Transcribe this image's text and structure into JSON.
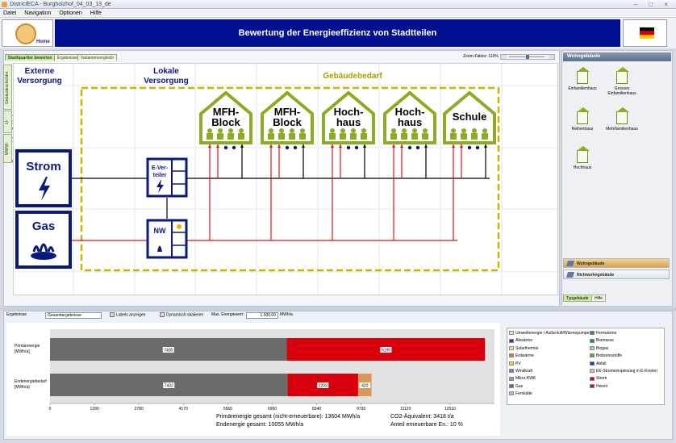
{
  "window": {
    "title": "DistrictECA - Burgholzhof_04_03_13_de",
    "controls": [
      "–",
      "□",
      "×"
    ]
  },
  "menu": [
    "Datei",
    "Navigation",
    "Optionen",
    "Hilfe"
  ],
  "header": {
    "home_label": "Home",
    "banner_title": "Bewertung der Energieeffizienz von Stadtteilen"
  },
  "tabs": [
    "Stadtquartier bewerten",
    "Ergebnisse",
    "Variantenvergleich"
  ],
  "zoom": {
    "label": "Zoom-Faktor: 110%",
    "value": 110
  },
  "side_tabs": [
    "Gebäudeschichtnr.",
    "IJ-Gebäude",
    "WWW-Prozessverteiler"
  ],
  "diagram": {
    "col_external": "Externe Versorgung",
    "col_local": "Lokale Versorgung",
    "col_demand": "Gebäudebedarf",
    "supply": [
      {
        "name": "Strom"
      },
      {
        "name": "Gas"
      }
    ],
    "local_nodes": [
      {
        "name": "E-Ver-teiler"
      },
      {
        "name": "NW"
      }
    ],
    "buildings": [
      {
        "name": "MFH-Block"
      },
      {
        "name": "MFH-Block"
      },
      {
        "name": "Hoch-haus"
      },
      {
        "name": "Hoch-haus"
      },
      {
        "name": "Schule"
      }
    ],
    "colors": {
      "green": "#8aad23",
      "navy": "#0a1a7a",
      "frame": "#c9b400",
      "red": "#d9141b"
    }
  },
  "right_panel": {
    "title": "Wohngebäude",
    "buildings": [
      "Einfamilienhaus",
      "Grosses Einfamilienhaus",
      "Reihenhaus",
      "Mehrfamilienhaus",
      "Hochhaus"
    ],
    "accordion": [
      "Wohngebäude",
      "Nichtwohngebäude"
    ],
    "bottom_tabs": [
      "Typgebäude",
      "Hilfe"
    ]
  },
  "results_bar": {
    "label": "Ergebnisse",
    "select": "Gesamtergebnisse",
    "labels_toggle": "Labels anzeigen",
    "scale_toggle": "Dynamisch skalieren",
    "max_label": "Max. Energiewert:",
    "max_value": "1.000,00",
    "max_unit": "MWh/a"
  },
  "chart_data": {
    "type": "bar",
    "orientation": "horizontal",
    "stacked": true,
    "categories": [
      "Primärenergie [MWh/a]",
      "Endenergiebedarf [MWh/a]"
    ],
    "series": [
      {
        "name": "Gas",
        "color": "#6b6b6b",
        "values": [
          7405,
          7432
        ],
        "labels": [
          "7405",
          "7432"
        ]
      },
      {
        "name": "Strom",
        "color": "#d8000c",
        "values": [
          6199,
          2203
        ],
        "labels": [
          "6199",
          "2203"
        ]
      },
      {
        "name": "Biomasse",
        "color": "#d99859",
        "values": [
          0,
          420
        ],
        "labels": [
          "",
          "420"
        ]
      }
    ],
    "xlim": [
      0,
      13900
    ],
    "x_ticks": [
      "0",
      "1390",
      "2780",
      "4170",
      "5560",
      "6950",
      "8340",
      "9730",
      "11120",
      "12510"
    ],
    "grid": false
  },
  "legend": [
    {
      "name": "Umweltenergie / Außenluft/Wärmepumpe",
      "color": "#e6e6e6"
    },
    {
      "name": "Fernwärme",
      "color": "#4f7f7a"
    },
    {
      "name": "Abwärme",
      "color": "#6a1f9a"
    },
    {
      "name": "Biomasse",
      "color": "#1f8f5f"
    },
    {
      "name": "Solarthermie",
      "color": "#f3e3a0"
    },
    {
      "name": "Biogas",
      "color": "#b5c98a"
    },
    {
      "name": "Erdwärme",
      "color": "#e0761d"
    },
    {
      "name": "Biobrennstoffe",
      "color": "#2fb82f"
    },
    {
      "name": "PV",
      "color": "#ffd42a"
    },
    {
      "name": "Abfall",
      "color": "#1836c8"
    },
    {
      "name": "Windkraft",
      "color": "#5f80d8"
    },
    {
      "name": "EE-Stromeinspeisung in E-Knoten",
      "color": "#f2b6b6"
    },
    {
      "name": "Mikro-KWK",
      "color": "#8f8fd0"
    },
    {
      "name": "Strom",
      "color": "#d8000c"
    },
    {
      "name": "Gas",
      "color": "#6b6b6b"
    },
    {
      "name": "Heizöl",
      "color": "#a0282a"
    },
    {
      "name": "Fernkälte",
      "color": "#bdbdbd"
    }
  ],
  "summary": {
    "primary": "Primärenergie gesamt (nicht-erneuerbare): 13604 MWh/a",
    "co2": "CO2-Äquivalent: 3418 t/a",
    "final": "Endenergie gesamt: 10055 MWh/a",
    "renewable": "Anteil erneuerbare En.: 10 %"
  }
}
